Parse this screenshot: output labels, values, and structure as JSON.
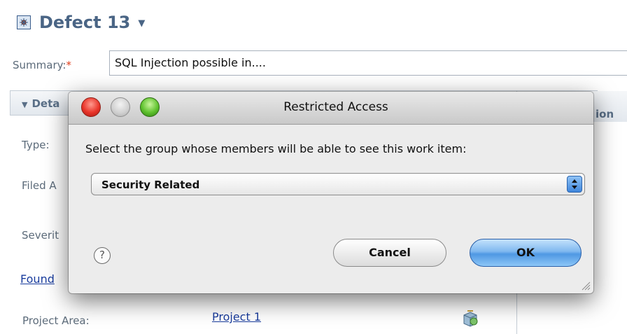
{
  "editor": {
    "title": "Defect 13",
    "title_dropdown_icon": "caret-down-icon",
    "work_item_icon": "defect-icon",
    "summary_label": "Summary:",
    "summary_required_mark": "*",
    "summary_value": "SQL Injection possible in....",
    "details_section_label": "Deta",
    "right_section_label": "ion",
    "fields": {
      "type_label": "Type:",
      "filed_label": "Filed A",
      "severity_label": "Severit",
      "found_link": "Found",
      "project_area_label": "Project Area:",
      "project_area_value": "Project 1"
    },
    "project_icon": "project-area-icon"
  },
  "dialog": {
    "title": "Restricted Access",
    "window_buttons": [
      "close",
      "minimize",
      "zoom"
    ],
    "prompt": "Select the group whose members will be able to see this work item:",
    "group_select": {
      "selected": "Security Related"
    },
    "help_symbol": "?",
    "cancel_label": "Cancel",
    "ok_label": "OK"
  }
}
